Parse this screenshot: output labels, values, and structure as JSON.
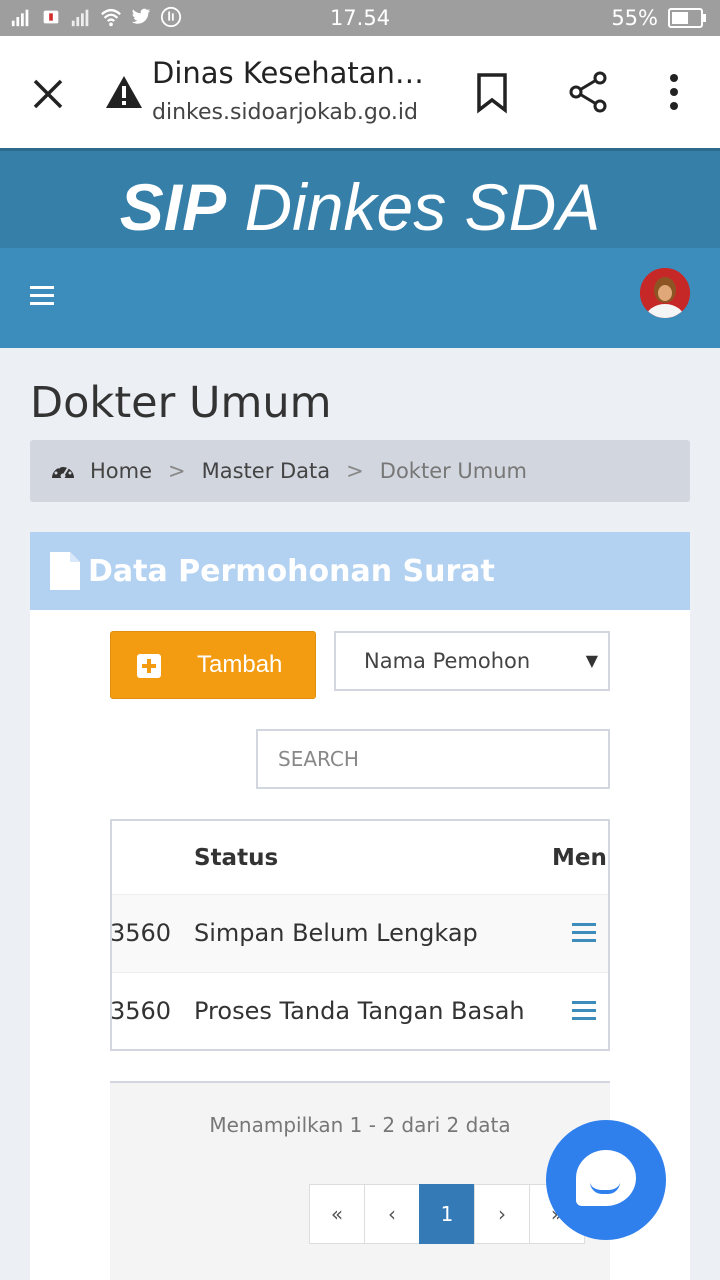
{
  "status_bar": {
    "time": "17.54",
    "battery": "55%"
  },
  "browser": {
    "title": "Dinas Kesehatan…",
    "url": "dinkes.sidoarjokab.go.id"
  },
  "site": {
    "brand_bold": "SIP",
    "brand_rest": "Dinkes SDA"
  },
  "page": {
    "title": "Dokter Umum",
    "breadcrumb": [
      "Home",
      "Master Data",
      "Dokter Umum"
    ],
    "breadcrumb_sep": ">"
  },
  "box": {
    "title": "Data Permohonan Surat",
    "add_label": "Tambah",
    "filter_selected": "Nama Pemohon",
    "search_placeholder": "SEARCH",
    "table": {
      "headers": [
        "Status",
        "Menu"
      ],
      "rows": [
        {
          "id_fragment": "3560",
          "status": "Simpan Belum Lengkap"
        },
        {
          "id_fragment": "3560",
          "status": "Proses Tanda Tangan Basah"
        }
      ]
    },
    "info": "Menampilkan 1 - 2 dari 2 data",
    "pagination": [
      "«",
      "‹",
      "1",
      "›",
      "»"
    ]
  },
  "colors": {
    "header_dark": "#367fa9",
    "header_nav": "#3c8dbc",
    "add_button": "#f39c12",
    "box_header": "#b3d2f2",
    "chat_button": "#2f80ed"
  },
  "icons": [
    "signal-icon",
    "wifi-icon",
    "twitter-icon",
    "battery-icon",
    "close-icon",
    "warning-icon",
    "bookmark-icon",
    "share-icon",
    "more-icon",
    "hamburger-icon",
    "avatar",
    "dashboard-icon",
    "document-icon",
    "plus-icon",
    "menu-icon",
    "chat-icon"
  ]
}
